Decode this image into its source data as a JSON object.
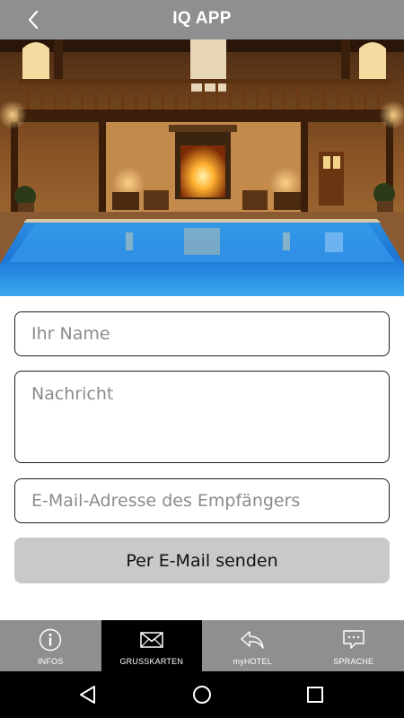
{
  "header": {
    "title": "IQ APP",
    "back_icon": "chevron-left-icon"
  },
  "hero": {
    "description_icon": "hotel-pool-photo"
  },
  "form": {
    "name_placeholder": "Ihr Name",
    "message_placeholder": "Nachricht",
    "email_placeholder": "E-Mail-Adresse des Empfängers",
    "send_label": "Per E-Mail senden"
  },
  "tabs": [
    {
      "label": "INFOS",
      "icon": "info-circle-icon",
      "active": false
    },
    {
      "label": "GRUSSKARTEN",
      "icon": "envelope-icon",
      "active": true
    },
    {
      "label": "myHOTEL",
      "icon": "reply-arrow-icon",
      "active": false
    },
    {
      "label": "SPRACHE",
      "icon": "chat-bubble-icon",
      "active": false
    }
  ],
  "system_nav": {
    "back_icon": "triangle-back-icon",
    "home_icon": "circle-home-icon",
    "recents_icon": "square-recents-icon"
  },
  "colors": {
    "header_bg": "#8f8f8f",
    "tab_active_bg": "#000000",
    "button_bg": "#c9c9c9"
  }
}
